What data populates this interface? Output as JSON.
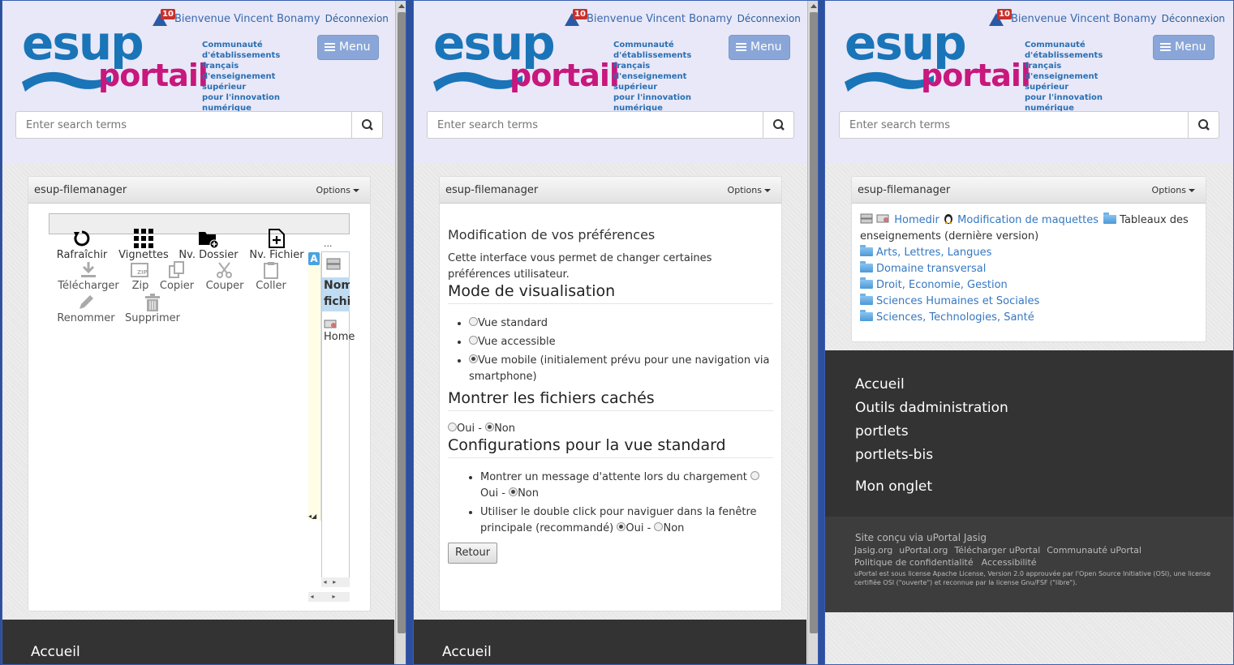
{
  "header": {
    "notification_count": "10",
    "welcome": "Bienvenue Vincent Bonamy",
    "logout": "Déconnexion",
    "logo_esup": "esup",
    "logo_portail": "portail",
    "tagline": [
      "Communauté",
      "d'établissements français",
      "d'enseignement supérieur",
      "pour l'innovation",
      "numérique"
    ],
    "menu_label": "Menu",
    "search_placeholder": "Enter search terms"
  },
  "portlet": {
    "title": "esup-filemanager",
    "options": "Options"
  },
  "pane1": {
    "toolbar": {
      "refresh": "Rafraîchir",
      "thumbnails": "Vignettes",
      "new_folder": "Nv. Dossier",
      "new_file": "Nv. Fichier",
      "download": "Télécharger",
      "zip": "Zip",
      "copy": "Copier",
      "cut": "Couper",
      "paste": "Coller",
      "rename": "Renommer",
      "delete": "Supprimer"
    },
    "ellipsis": "...",
    "col_name_1": "Nom",
    "col_name_2": "fichi",
    "home": "Home",
    "a_tag": "A",
    "nav_accueil": "Accueil"
  },
  "pane2": {
    "heading": "Modification de vos préférences",
    "intro": "Cette interface vous permet de changer certaines préférences utilisateur.",
    "mode_title": "Mode de visualisation",
    "mode_options": [
      "Vue standard",
      "Vue accessible",
      "Vue mobile (initialement prévu pour une navigation via smartphone)"
    ],
    "hidden_title": "Montrer les fichiers cachés",
    "oui": "Oui",
    "non": "Non",
    "sep": " - ",
    "config_title": "Configurations pour la vue standard",
    "config_items": [
      "Montrer un message d'attente lors du chargement",
      "Utiliser le double click pour naviguer dans la fenêtre principale (recommandé)"
    ],
    "back": "Retour",
    "nav_accueil": "Accueil"
  },
  "pane3": {
    "breadcrumb": {
      "homedir": "Homedir",
      "maquettes": "Modification de maquettes",
      "current": "Tableaux des enseignements (dernière version)"
    },
    "folders": [
      "Arts, Lettres, Langues",
      "Domaine transversal",
      "Droit, Economie, Gestion",
      "Sciences Humaines et Sociales",
      "Sciences, Technologies, Santé"
    ],
    "nav": [
      "Accueil",
      "Outils dadministration",
      "portlets",
      "portlets-bis",
      "Mon onglet"
    ],
    "footer": {
      "site": "Site conçu via uPortal Jasig",
      "links1": [
        "Jasig.org",
        "uPortal.org",
        "Télécharger uPortal",
        "Communauté uPortal"
      ],
      "links2": [
        "Politique de confidentialité",
        "Accessibilité"
      ],
      "license": "uPortal est sous license Apache License, Version 2.0 approuvée par l'Open Source Initiative (OSI), une license certifiée OSI (\"ouverte\") et reconnue par la license Gnu/FSF (\"libre\")."
    }
  },
  "colors": {
    "brand_blue": "#1a74b8",
    "brand_pink": "#c8177d",
    "link": "#3577c1",
    "header_bg": "#e8e8f8",
    "footer_bg": "#333333"
  }
}
